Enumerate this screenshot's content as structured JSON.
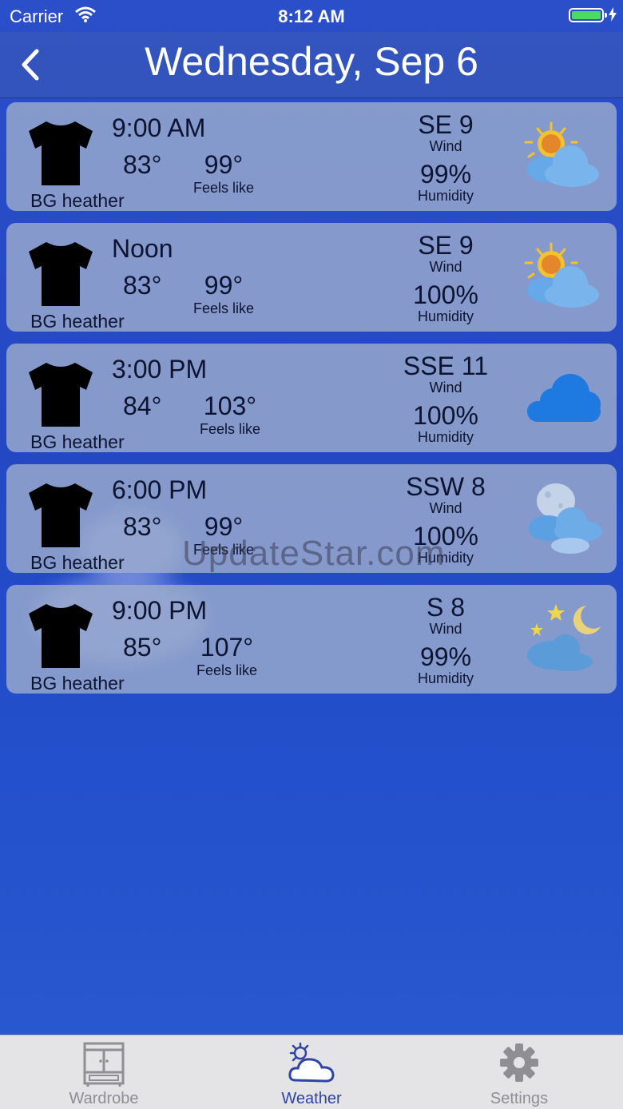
{
  "status_bar": {
    "carrier": "Carrier",
    "time": "8:12 AM"
  },
  "nav": {
    "title": "Wednesday, Sep 6"
  },
  "forecasts": [
    {
      "time": "9:00 AM",
      "temp": "83°",
      "feels_like": "99°",
      "feels_label": "Feels like",
      "wind": "SE 9",
      "wind_label": "Wind",
      "humidity": "99%",
      "humidity_label": "Humidity",
      "clothing": "BG heather",
      "icon": "sun-cloud-icon"
    },
    {
      "time": "Noon",
      "temp": "83°",
      "feels_like": "99°",
      "feels_label": "Feels like",
      "wind": "SE 9",
      "wind_label": "Wind",
      "humidity": "100%",
      "humidity_label": "Humidity",
      "clothing": "BG heather",
      "icon": "sun-cloud-icon"
    },
    {
      "time": "3:00 PM",
      "temp": "84°",
      "feels_like": "103°",
      "feels_label": "Feels like",
      "wind": "SSE 11",
      "wind_label": "Wind",
      "humidity": "100%",
      "humidity_label": "Humidity",
      "clothing": "BG heather",
      "icon": "cloud-icon"
    },
    {
      "time": "6:00 PM",
      "temp": "83°",
      "feels_like": "99°",
      "feels_label": "Feels like",
      "wind": "SSW 8",
      "wind_label": "Wind",
      "humidity": "100%",
      "humidity_label": "Humidity",
      "clothing": "BG heather",
      "icon": "moon-cloud-icon"
    },
    {
      "time": "9:00 PM",
      "temp": "85°",
      "feels_like": "107°",
      "feels_label": "Feels like",
      "wind": "S 8",
      "wind_label": "Wind",
      "humidity": "99%",
      "humidity_label": "Humidity",
      "clothing": "BG heather",
      "icon": "night-cloud-icon"
    }
  ],
  "watermark": "UpdateStar.com",
  "tabs": [
    {
      "label": "Wardrobe",
      "icon": "wardrobe-icon"
    },
    {
      "label": "Weather",
      "icon": "weather-icon",
      "active": true
    },
    {
      "label": "Settings",
      "icon": "gear-icon"
    }
  ],
  "colors": {
    "accent": "#2f44a6",
    "battery": "#4cd964"
  }
}
